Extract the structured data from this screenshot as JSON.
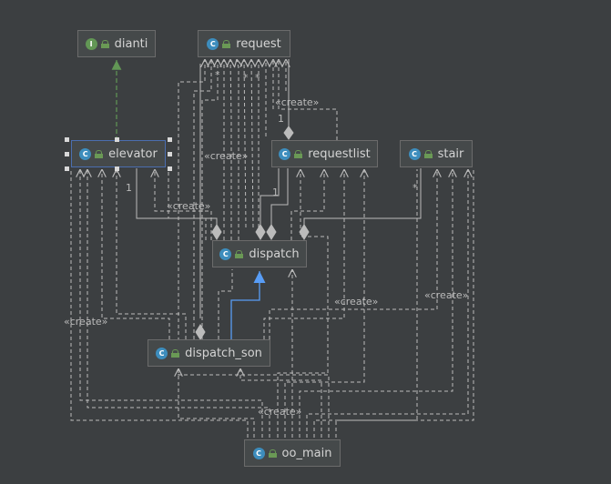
{
  "nodes": {
    "dianti": {
      "name": "dianti",
      "kind": "I"
    },
    "request": {
      "name": "request",
      "kind": "C"
    },
    "elevator": {
      "name": "elevator",
      "kind": "C"
    },
    "requestlist": {
      "name": "requestlist",
      "kind": "C"
    },
    "stair": {
      "name": "stair",
      "kind": "C"
    },
    "dispatch": {
      "name": "dispatch",
      "kind": "C"
    },
    "dispatch_son": {
      "name": "dispatch_son",
      "kind": "C"
    },
    "oo_main": {
      "name": "oo_main",
      "kind": "C"
    }
  },
  "labels": {
    "create": "«create»",
    "mult_star": "*",
    "mult_one": "1"
  },
  "colors": {
    "background": "#3c3f41",
    "node_fill": "#45494a",
    "dashed_line": "#bbbbbb",
    "realization_arrow": "#629755",
    "inheritance_arrow": "#589df6"
  }
}
